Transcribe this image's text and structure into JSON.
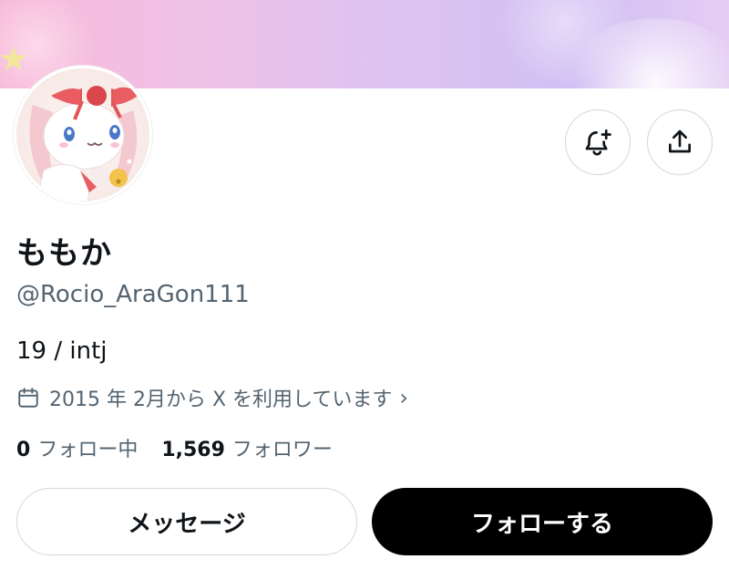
{
  "profile": {
    "display_name": "ももか",
    "handle": "@Rocio_AraGon111",
    "bio": "19 / intj",
    "joined": "2015 年 2月から X を利用しています",
    "following_count": "0",
    "following_label": "フォロー中",
    "followers_count": "1,569",
    "followers_label": "フォロワー"
  },
  "actions": {
    "message_label": "メッセージ",
    "follow_label": "フォローする",
    "notify_icon": "bell-plus-icon",
    "share_icon": "share-icon"
  },
  "colors": {
    "text_primary": "#0f1419",
    "text_secondary": "#536471",
    "border": "#cfd9de",
    "follow_bg": "#000000",
    "follow_text": "#ffffff"
  }
}
